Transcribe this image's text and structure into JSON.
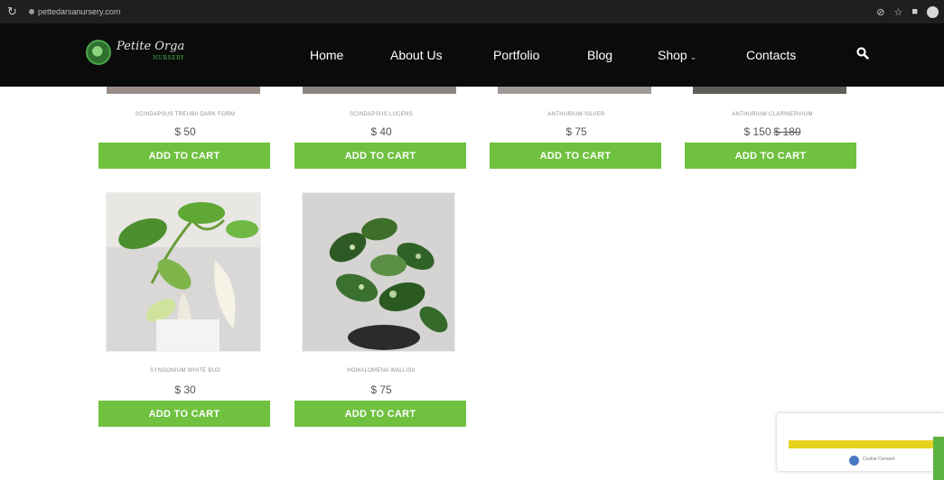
{
  "browser": {
    "url": "pettedarsanursery.com"
  },
  "header": {
    "logo_text": "Petite Orga",
    "logo_sub": "NURSERY",
    "nav": {
      "home": "Home",
      "about": "About Us",
      "portfolio": "Portfolio",
      "blog": "Blog",
      "shop": "Shop",
      "contacts": "Contacts"
    }
  },
  "products": [
    {
      "name": "SCINDAPSUS TREUBII DARK FORM",
      "price": "$ 50"
    },
    {
      "name": "SCINDAPSUS LUCENS",
      "price": "$ 40"
    },
    {
      "name": "ANTHURIUM SILVER",
      "price": "$ 75"
    },
    {
      "name": "ANTHURIUM CLARINERVIUM",
      "price": "$ 150",
      "old_price": "$ 180"
    },
    {
      "name": "SYNGONIUM WHITE BUD",
      "price": "$ 30"
    },
    {
      "name": "HOMALOMENA WALLISII",
      "price": "$ 75"
    }
  ],
  "cart_label": "ADD TO CART",
  "widget": {
    "text": "Cookie Consent"
  },
  "colors": {
    "accent": "#6fc13f",
    "header_bg": "#0b0b0b"
  }
}
